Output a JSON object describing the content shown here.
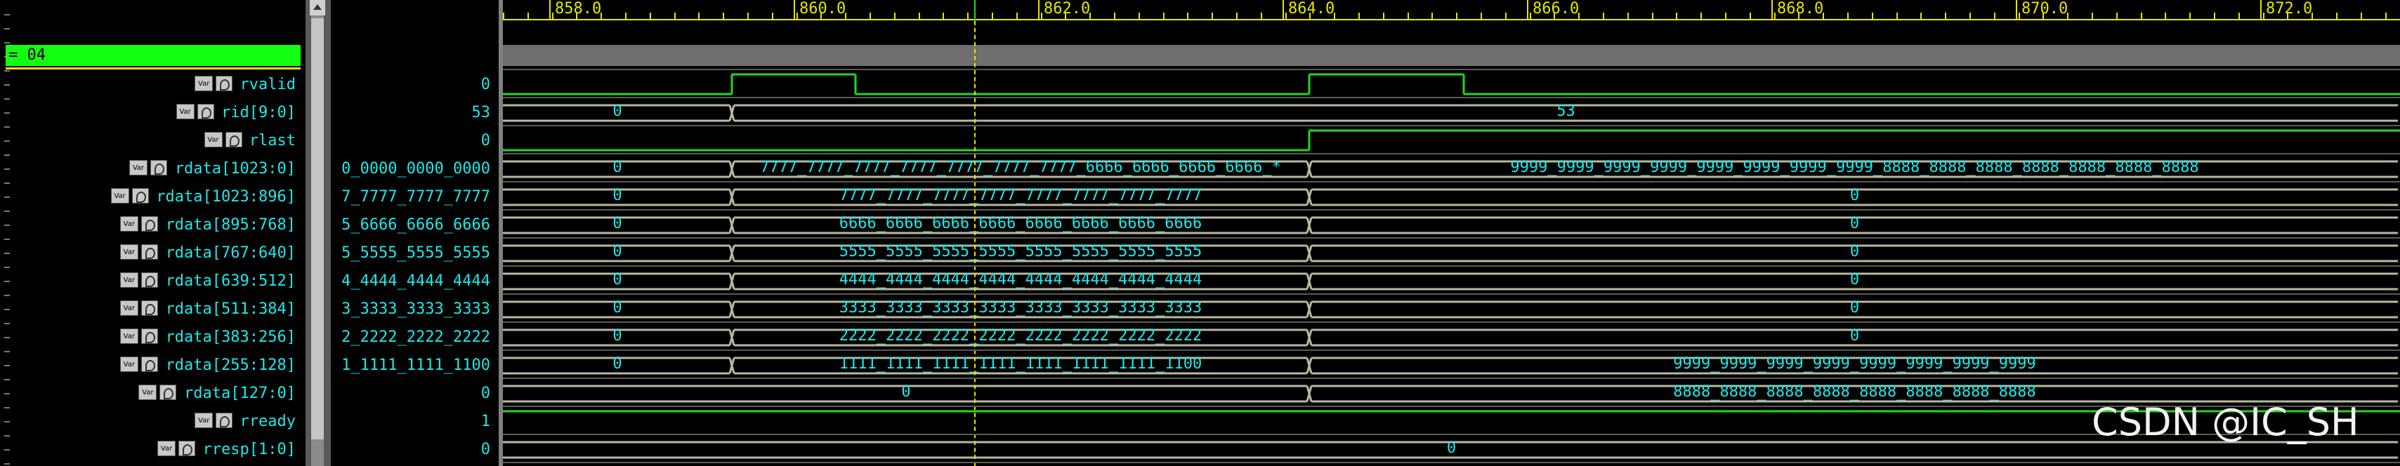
{
  "group": {
    "label": "= 04"
  },
  "signals": [
    {
      "name": "rvalid",
      "value": "0"
    },
    {
      "name": "rid[9:0]",
      "value": "53"
    },
    {
      "name": "rlast",
      "value": "0"
    },
    {
      "name": "rdata[1023:0]",
      "value": "0_0000_0000_0000"
    },
    {
      "name": "rdata[1023:896]",
      "value": "7_7777_7777_7777"
    },
    {
      "name": "rdata[895:768]",
      "value": "5_6666_6666_6666"
    },
    {
      "name": "rdata[767:640]",
      "value": "5_5555_5555_5555"
    },
    {
      "name": "rdata[639:512]",
      "value": "4_4444_4444_4444"
    },
    {
      "name": "rdata[511:384]",
      "value": "3_3333_3333_3333"
    },
    {
      "name": "rdata[383:256]",
      "value": "2_2222_2222_2222"
    },
    {
      "name": "rdata[255:128]",
      "value": "1_1111_1111_1100"
    },
    {
      "name": "rdata[127:0]",
      "value": "0"
    },
    {
      "name": "rready",
      "value": "1"
    },
    {
      "name": "rresp[1:0]",
      "value": "0"
    }
  ],
  "icons": {
    "var": "Var",
    "wave": "wave-icon"
  },
  "ruler": {
    "labels": [
      "858.0",
      "860.0",
      "862.0",
      "864.0",
      "866.0",
      "868.0",
      "870.0",
      "872.0"
    ]
  },
  "bus_values": {
    "rid": [
      "0",
      "53"
    ],
    "rdata": [
      "0",
      "7777_7777_7777_7777_7777_7777_7777_6666_6666_6666_6666_*",
      "9999_9999_9999_9999_9999_9999_9999_9999_8888_8888_8888_8888_8888_8888_8888"
    ],
    "r1023": [
      "0",
      "7777_7777_7777_7777_7777_7777_7777_7777",
      "0"
    ],
    "r895": [
      "0",
      "6666_6666_6666_6666_6666_6666_6666_6666",
      "0"
    ],
    "r767": [
      "0",
      "5555_5555_5555_5555_5555_5555_5555_5555",
      "0"
    ],
    "r639": [
      "0",
      "4444_4444_4444_4444_4444_4444_4444_4444",
      "0"
    ],
    "r511": [
      "0",
      "3333_3333_3333_3333_3333_3333_3333_3333",
      "0"
    ],
    "r383": [
      "0",
      "2222_2222_2222_2222_2222_2222_2222_2222",
      "0"
    ],
    "r255": [
      "0",
      "1111_1111_1111_1111_1111_1111_1111_1100",
      "9999_9999_9999_9999_9999_9999_9999_9999"
    ],
    "r127": [
      "0",
      "8888_8888_8888_8888_8888_8888_8888_8888"
    ],
    "rresp": [
      "0"
    ]
  },
  "colors": {
    "wave": "#1fd81f",
    "bus": "#b8b8a0",
    "text": "#1fe8e8",
    "ruler": "#e6e600"
  },
  "watermark": "CSDN @IC_SH"
}
